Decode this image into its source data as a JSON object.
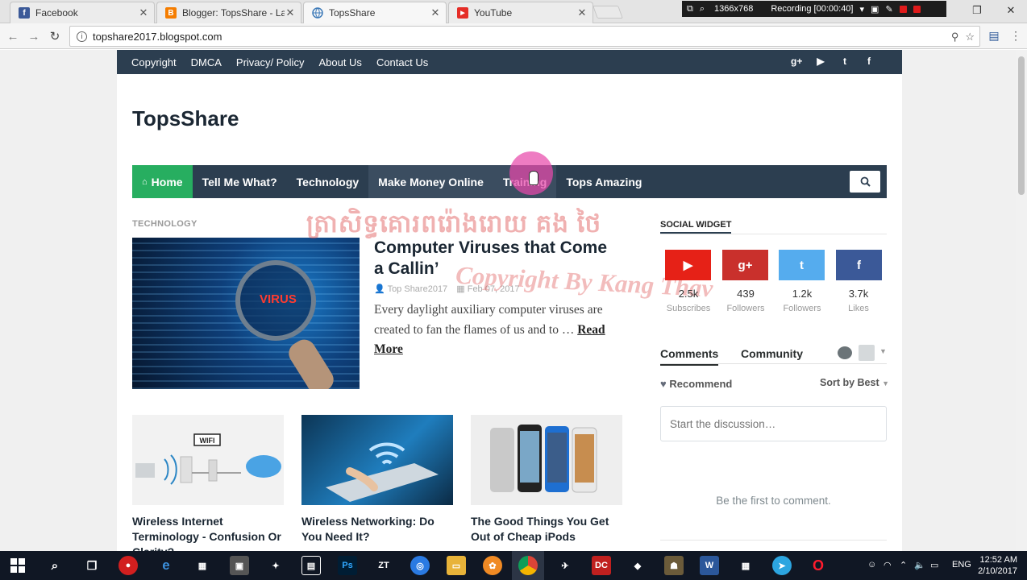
{
  "browser": {
    "tabs": [
      {
        "title": "Facebook",
        "favicon_letter": "f",
        "favicon_color": "#3b5998",
        "active": false
      },
      {
        "title": "Blogger: TopsShare - Lay",
        "favicon_letter": "B",
        "favicon_color": "#f57d00",
        "active": false
      },
      {
        "title": "TopsShare",
        "favicon_letter": "",
        "favicon_color": "#3d7ab8",
        "active": true
      },
      {
        "title": "YouTube",
        "favicon_letter": "▶",
        "favicon_color": "#e52d27",
        "active": false
      }
    ],
    "close_glyph": "✕",
    "url": "topshare2017.blogspot.com",
    "recorder": {
      "resolution": "1366x768",
      "status": "Recording [00:00:40]"
    }
  },
  "site": {
    "topbar_links": [
      "Copyright",
      "DMCA",
      "Privacy/ Policy",
      "About Us",
      "Contact Us"
    ],
    "social_top_icons": [
      "google-plus-icon",
      "youtube-icon",
      "twitter-icon",
      "facebook-icon"
    ],
    "title": "TopsShare",
    "nav": [
      {
        "label": "Home",
        "highlight": "home"
      },
      {
        "label": "Tell Me What?",
        "highlight": ""
      },
      {
        "label": "Technology",
        "highlight": ""
      },
      {
        "label": "Make Money Online",
        "highlight": "hover"
      },
      {
        "label": "Training",
        "highlight": "hover"
      },
      {
        "label": "Tops Amazing",
        "highlight": ""
      }
    ],
    "colors": {
      "topbar": "#2c3e50",
      "home": "#27ae60",
      "watermark": "#dc4646"
    }
  },
  "featured": {
    "category": "TECHNOLOGY",
    "image_text": "VIRUS",
    "title": "Computer Viruses that Come a Callin’",
    "author": "Top Share2017",
    "date": "Feb 07, 2017",
    "excerpt": "Every daylight auxiliary computer viruses are created to fan the flames of us and to …",
    "read_more": "Read More"
  },
  "watermark": {
    "khmer": "ត្រាសិទ្ធគោរពរ៉ោងរោយ គង ថៃ",
    "latin": "Copyright By Kang Thav"
  },
  "posts": [
    {
      "title": "Wireless Internet Terminology - Confusion Or Clarity?",
      "image_text": "WIFI"
    },
    {
      "title": "Wireless Networking: Do You Need It?"
    },
    {
      "title": "The Good Things You Get Out of Cheap iPods"
    }
  ],
  "sidebar": {
    "social_widget_title": "SOCIAL WIDGET",
    "social": [
      {
        "icon": "youtube-icon",
        "count": "2.5k",
        "label": "Subscribes",
        "color": "#e62117"
      },
      {
        "icon": "google-plus-icon",
        "count": "439",
        "label": "Followers",
        "color": "#c9302c"
      },
      {
        "icon": "twitter-icon",
        "count": "1.2k",
        "label": "Followers",
        "color": "#55acee"
      },
      {
        "icon": "facebook-icon",
        "count": "3.7k",
        "label": "Likes",
        "color": "#3b5998"
      }
    ],
    "comments": {
      "tab_comments": "Comments",
      "tab_community": "Community",
      "recommend": "Recommend",
      "sort": "Sort by Best",
      "placeholder": "Start the discussion…",
      "empty": "Be the first to comment."
    }
  },
  "taskbar": {
    "language": "ENG",
    "time": "12:52 AM",
    "date": "2/10/2017"
  }
}
